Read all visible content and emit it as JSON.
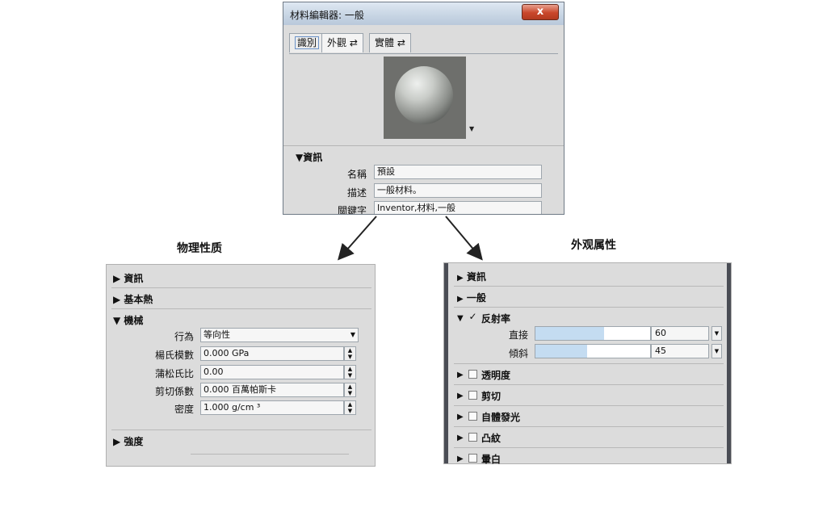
{
  "dialog": {
    "title": "材料編輯器: 一般",
    "close_glyph": "x",
    "tabs": [
      {
        "label": "識別"
      },
      {
        "label": "外觀",
        "icon": "swap-arrows-icon"
      },
      {
        "label": "實體",
        "icon": "swap-arrows-icon"
      }
    ],
    "swap_glyph": "⇄",
    "info_section": "▼資訊",
    "fields": [
      {
        "label": "名稱",
        "value": "預設"
      },
      {
        "label": "描述",
        "value": "一般材料。"
      },
      {
        "label": "關鍵字",
        "value": "Inventor,材料,一般"
      }
    ]
  },
  "headings": {
    "physical": "物理性质",
    "appearance": "外观属性"
  },
  "physical_panel": {
    "sections": {
      "info": "▶ 資訊",
      "thermal": "▶ 基本熱",
      "mechanical": "▼ 機械",
      "strength": "▶ 強度"
    },
    "properties": [
      {
        "label": "行為",
        "value": "等向性",
        "control": "select"
      },
      {
        "label": "楊氏模數",
        "value": "0.000 GPa",
        "control": "spin"
      },
      {
        "label": "蒲松氏比",
        "value": "0.00",
        "control": "spin"
      },
      {
        "label": "剪切係數",
        "value": "0.000 百萬帕斯卡",
        "control": "spin"
      },
      {
        "label": "密度",
        "value": "1.000 g/cm ³",
        "control": "spin"
      }
    ]
  },
  "appearance_panel": {
    "sections": [
      {
        "label": "資訊",
        "checkbox": false
      },
      {
        "label": "一般",
        "checkbox": false
      },
      {
        "label": "反射率",
        "checkbox": true,
        "checked": true,
        "expanded": true
      },
      {
        "label": "透明度",
        "checkbox": true,
        "checked": false
      },
      {
        "label": "剪切",
        "checkbox": true,
        "checked": false
      },
      {
        "label": "自體發光",
        "checkbox": true,
        "checked": false
      },
      {
        "label": "凸紋",
        "checkbox": true,
        "checked": false
      },
      {
        "label": "暈白",
        "checkbox": true,
        "checked": false
      }
    ],
    "reflectivity": [
      {
        "label": "直接",
        "value": "60",
        "fill": 0.6
      },
      {
        "label": "傾斜",
        "value": "45",
        "fill": 0.45
      }
    ]
  },
  "colors": {
    "panel_bg": "#dcdcdc",
    "bar_fill": "#c4dcf1",
    "close_red": "#c9472b"
  }
}
